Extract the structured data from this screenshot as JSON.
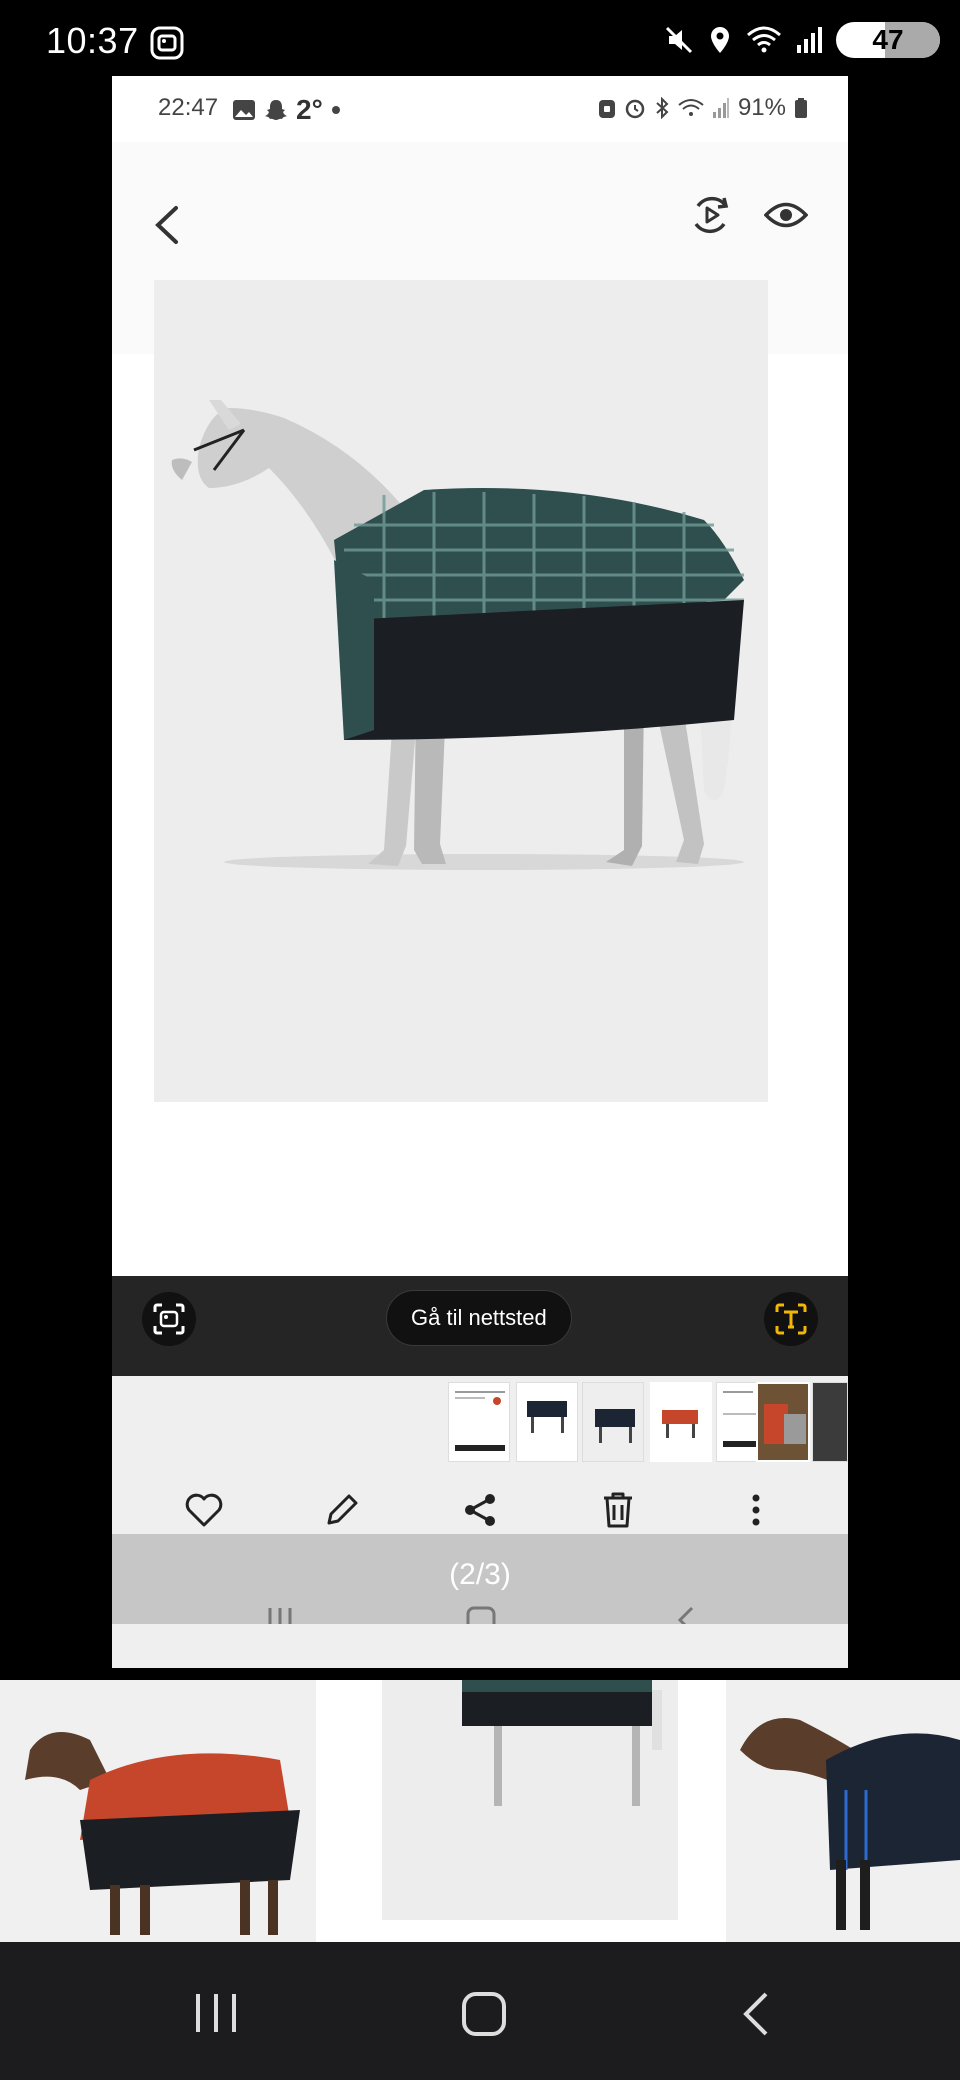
{
  "outer_status": {
    "time": "10:37",
    "battery": "47"
  },
  "inner_status": {
    "time": "22:47",
    "temperature": "2°",
    "battery": "91%"
  },
  "viewer_toolbar": {
    "goto_label": "Gå til nettsted"
  },
  "viewer": {
    "counter": "(2/3)"
  },
  "colors": {
    "accent_text_tool": "#f2b705",
    "dark_toolbar": "#252525",
    "photo_bg": "#ededed",
    "rug_plaid": "#2f4f4f",
    "rug_orange": "#c6462b",
    "rug_navy": "#1b2533"
  },
  "icons": {
    "outer_left": "screen-capture-icon",
    "outer_right": [
      "mute-icon",
      "location-icon",
      "wifi-icon",
      "signal-icon",
      "battery-icon"
    ],
    "inner_appbar": [
      "back-icon",
      "motion-photo-icon",
      "eye-icon"
    ],
    "actions": [
      "heart-icon",
      "edit-icon",
      "share-icon",
      "delete-icon",
      "more-icon"
    ]
  }
}
